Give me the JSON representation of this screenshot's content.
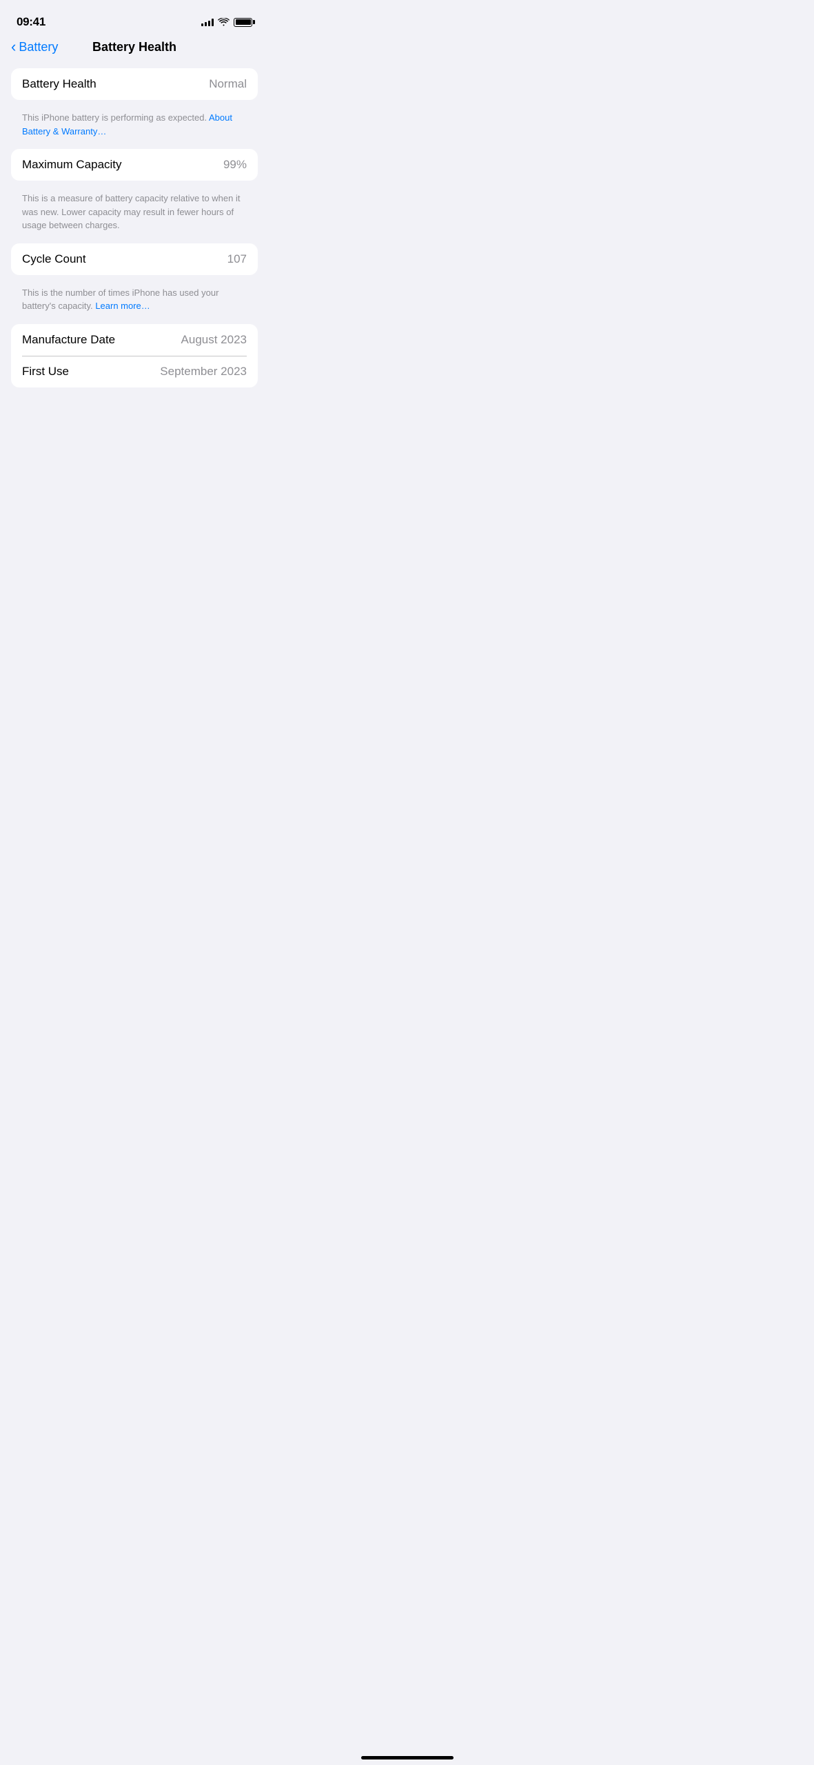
{
  "statusBar": {
    "time": "09:41"
  },
  "navBar": {
    "backLabel": "Battery",
    "title": "Battery Health"
  },
  "sections": {
    "batteryHealth": {
      "label": "Battery Health",
      "value": "Normal",
      "description": "This iPhone battery is performing as expected.",
      "linkText": "About Battery & Warranty…"
    },
    "maximumCapacity": {
      "label": "Maximum Capacity",
      "value": "99%",
      "description": "This is a measure of battery capacity relative to when it was new. Lower capacity may result in fewer hours of usage between charges."
    },
    "cycleCount": {
      "label": "Cycle Count",
      "value": "107",
      "description": "This is the number of times iPhone has used your battery's capacity.",
      "linkText": "Learn more…"
    },
    "manufactureDate": {
      "label": "Manufacture Date",
      "value": "August 2023"
    },
    "firstUse": {
      "label": "First Use",
      "value": "September 2023"
    }
  }
}
